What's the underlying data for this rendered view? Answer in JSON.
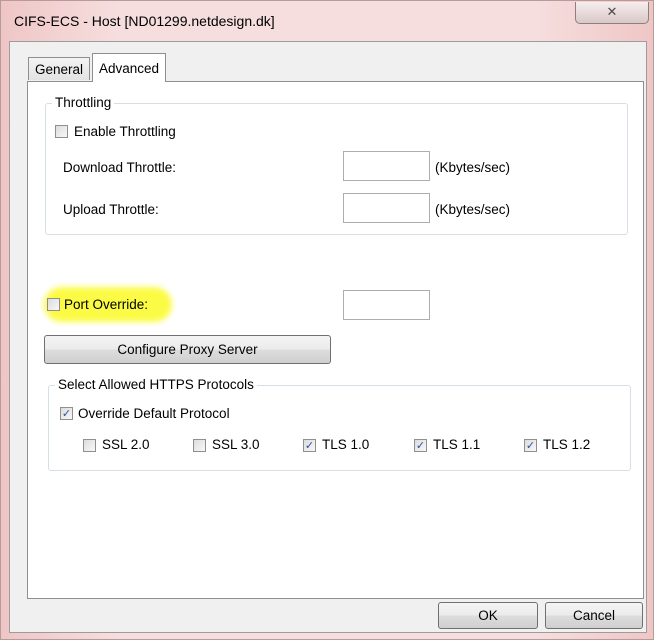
{
  "window": {
    "title": "CIFS-ECS - Host [ND01299.netdesign.dk]",
    "close_icon": "close-icon"
  },
  "tabs": [
    {
      "label": "General"
    },
    {
      "label": "Advanced"
    }
  ],
  "throttling": {
    "group_label": "Throttling",
    "enable_label": "Enable Throttling",
    "enable_checked": false,
    "download_label": "Download Throttle:",
    "download_value": "",
    "download_unit": "(Kbytes/sec)",
    "upload_label": "Upload Throttle:",
    "upload_value": "",
    "upload_unit": "(Kbytes/sec)"
  },
  "port_override": {
    "label": "Port Override:",
    "checked": false,
    "value": "",
    "highlight_color": "#fbfb3c"
  },
  "proxy": {
    "button_label": "Configure Proxy Server"
  },
  "https": {
    "group_label": "Select Allowed HTTPS Protocols",
    "override_label": "Override Default Protocol",
    "override_checked": true,
    "protocols": [
      {
        "label": "SSL 2.0",
        "checked": false
      },
      {
        "label": "SSL 3.0",
        "checked": false
      },
      {
        "label": "TLS 1.0",
        "checked": true
      },
      {
        "label": "TLS 1.1",
        "checked": true
      },
      {
        "label": "TLS 1.2",
        "checked": true
      }
    ]
  },
  "footer": {
    "ok_label": "OK",
    "cancel_label": "Cancel"
  },
  "check_glyph": "✓"
}
